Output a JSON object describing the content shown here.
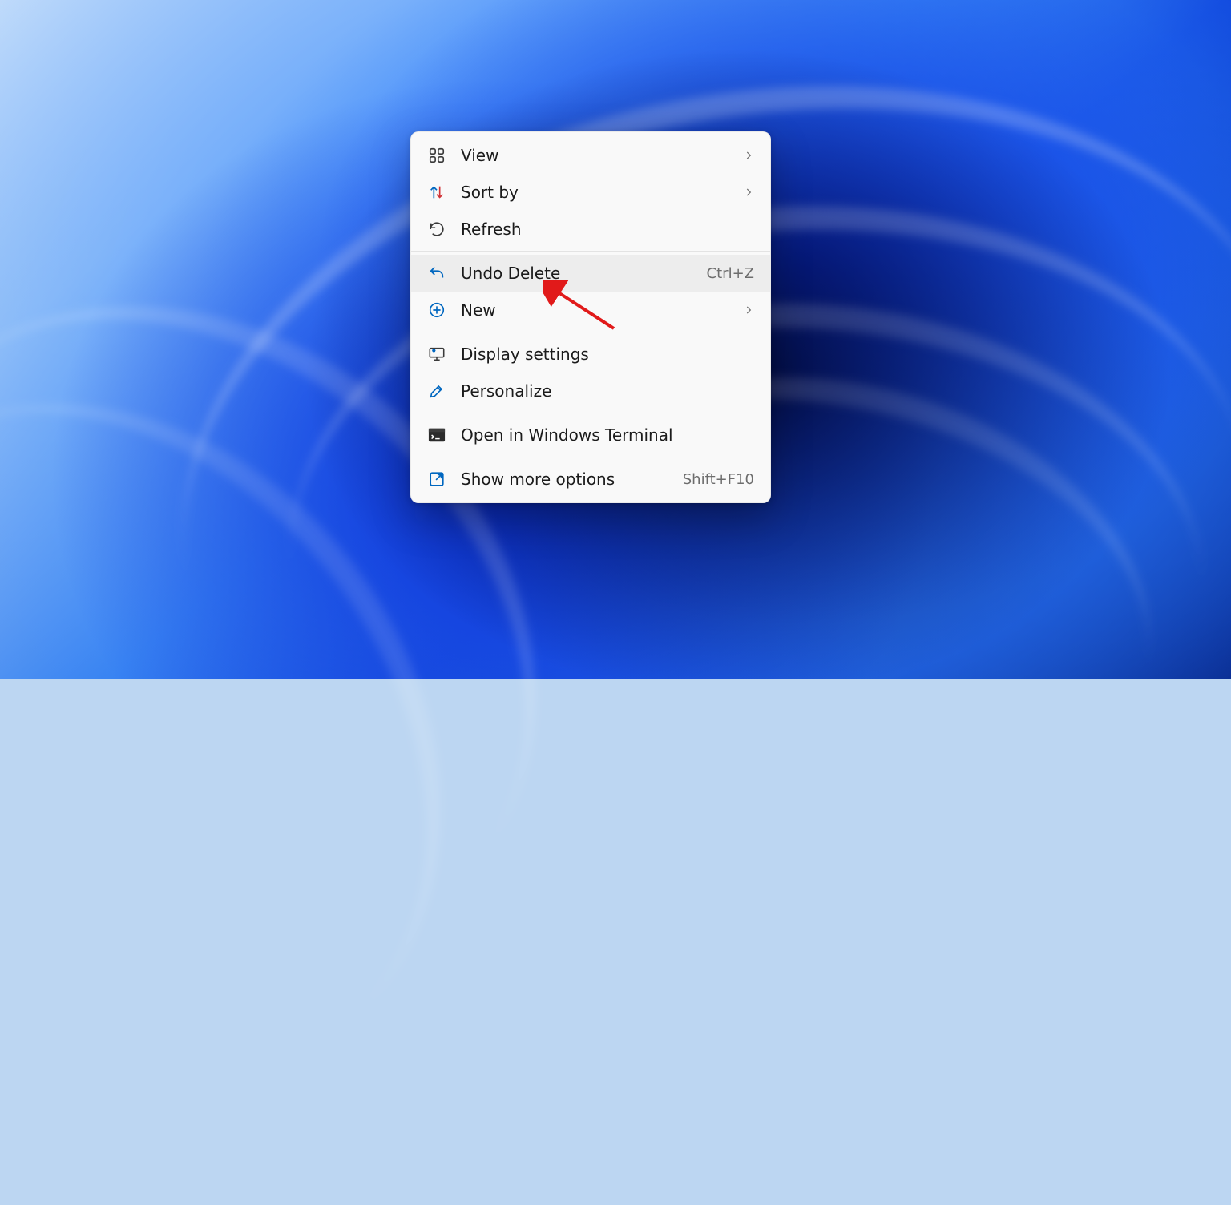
{
  "context_menu": {
    "items": [
      {
        "id": "view",
        "label": "View",
        "submenu": true,
        "icon": "grid-icon"
      },
      {
        "id": "sort",
        "label": "Sort by",
        "submenu": true,
        "icon": "sort-arrows-icon"
      },
      {
        "id": "refresh",
        "label": "Refresh",
        "icon": "refresh-icon"
      },
      {
        "sep": true
      },
      {
        "id": "undo",
        "label": "Undo Delete",
        "shortcut": "Ctrl+Z",
        "icon": "undo-icon",
        "hover": true,
        "accent": true
      },
      {
        "id": "new",
        "label": "New",
        "submenu": true,
        "icon": "plus-circle-icon"
      },
      {
        "sep": true
      },
      {
        "id": "display",
        "label": "Display settings",
        "icon": "monitor-gear-icon"
      },
      {
        "id": "personalize",
        "label": "Personalize",
        "icon": "brush-icon",
        "accent": true
      },
      {
        "sep": true
      },
      {
        "id": "terminal",
        "label": "Open in Windows Terminal",
        "icon": "terminal-icon"
      },
      {
        "sep": true
      },
      {
        "id": "more",
        "label": "Show more options",
        "shortcut": "Shift+F10",
        "icon": "expand-icon"
      }
    ]
  },
  "colors": {
    "accent": "#0067c0",
    "menu_bg": "#f9f9f9",
    "menu_hover": "#ededed",
    "text": "#1b1b1b",
    "text_muted": "#6d6d6d",
    "annotation": "#e11a1a"
  }
}
